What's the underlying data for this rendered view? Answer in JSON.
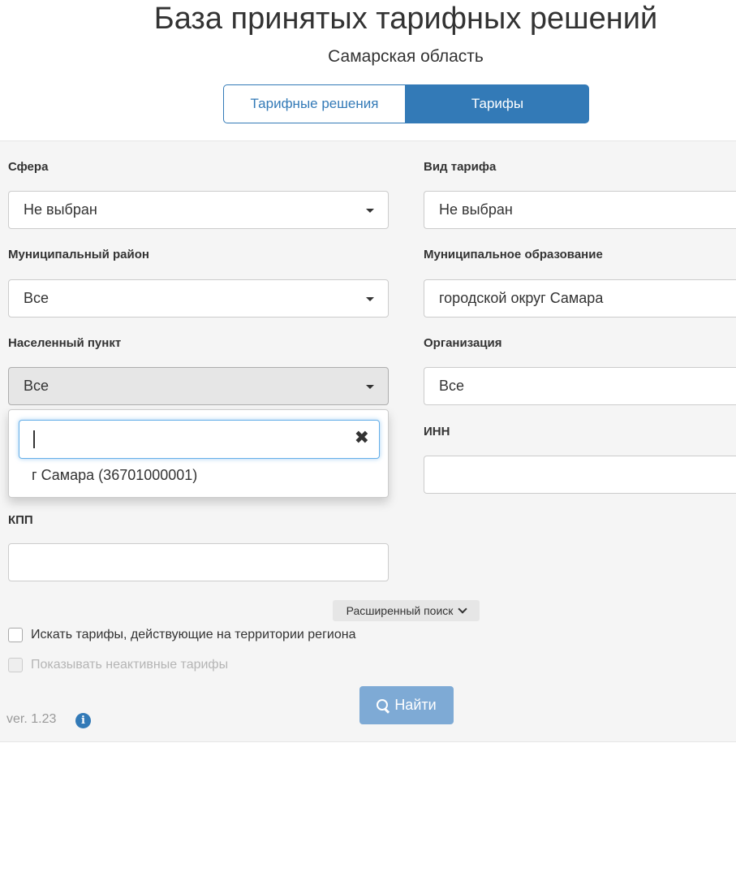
{
  "header": {
    "title": "База принятых тарифных решений",
    "subtitle": "Самарская область"
  },
  "tabs": {
    "left_label": "Тарифные решения",
    "right_label": "Тарифы",
    "active": "Тарифы"
  },
  "filters": {
    "sfera": {
      "label": "Сфера",
      "value": "Не выбран"
    },
    "vid_tarifa": {
      "label": "Вид тарифа",
      "value": "Не выбран"
    },
    "mun_rayon": {
      "label": "Муниципальный район",
      "value": "Все"
    },
    "mun_obrazovanie": {
      "label": "Муниципальное образование",
      "value": "городской округ Самара"
    },
    "nas_punkt": {
      "label": "Населенный пункт",
      "value": "Все"
    },
    "organizaciya": {
      "label": "Организация",
      "value": "Все"
    },
    "inn": {
      "label": "ИНН",
      "value": ""
    },
    "kpp": {
      "label": "КПП",
      "value": ""
    }
  },
  "dropdown": {
    "search_value": "",
    "clear_icon": "close-icon",
    "options": [
      "г Самара (36701000001)"
    ]
  },
  "advanced_search": {
    "label": "Расширенный поиск"
  },
  "checkboxes": {
    "region_tariffs": {
      "label": "Искать тарифы, действующие на территории региона",
      "checked": false
    },
    "inactive_tariffs": {
      "label": "Показывать неактивные тарифы",
      "checked": false,
      "disabled": true
    }
  },
  "search_button": {
    "label": "Найти"
  },
  "footer": {
    "version": "ver. 1.23",
    "info_icon": "info-icon"
  },
  "colors": {
    "primary": "#337ab7",
    "panel_bg": "#f5f5f5",
    "search_btn": "#7eaad5"
  }
}
